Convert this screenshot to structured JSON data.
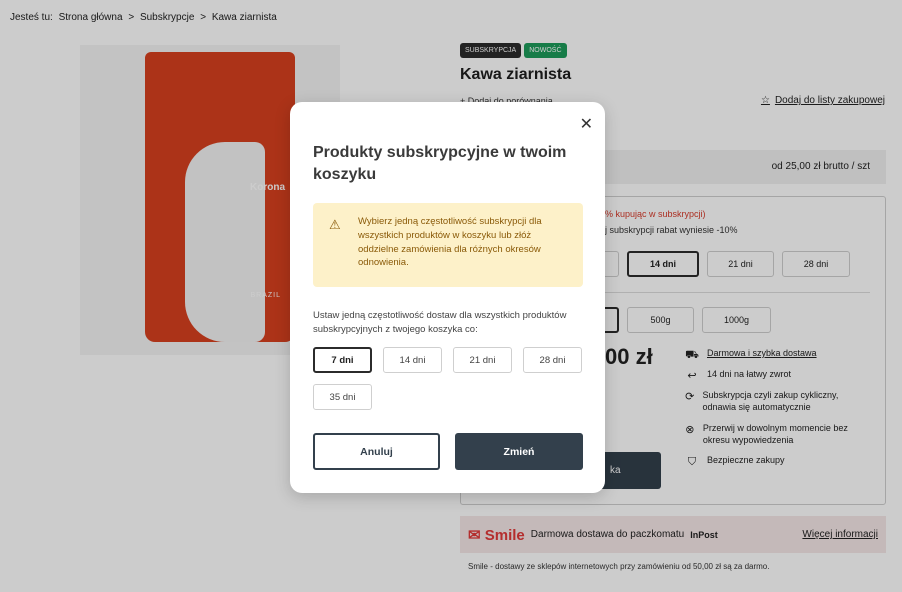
{
  "breadcrumb": {
    "prefix": "Jesteś tu:",
    "items": [
      "Strona główna",
      ">",
      "Subskrypcje",
      ">",
      "Kawa ziarnista"
    ]
  },
  "product": {
    "badges": [
      "SUBSKRYPCJA",
      "NOWOŚĆ"
    ],
    "title": "Kawa ziarnista",
    "compare": "+ Dodaj do porównania",
    "shopping_list": "Dodaj do listy zakupowej",
    "price_from": "od 25,00 zł  brutto / szt",
    "bag_brand": "Korona",
    "bag_origin": "BRAZIL"
  },
  "config": {
    "discount_red": "5% kupując w subskrypcji)",
    "discount_info": "ej subskrypcji rabat wyniesie -10%",
    "frequency_bg": [
      "14 dni",
      "21 dni",
      "28 dni"
    ],
    "weights": [
      "500g",
      "1000g"
    ],
    "price_partial": "00 zł",
    "add_to_cart_partial": "ka"
  },
  "perks": [
    {
      "icon": "truck-icon",
      "text": "Darmowa i szybka dostawa"
    },
    {
      "icon": "return-icon",
      "text": "14 dni na łatwy zwrot"
    },
    {
      "icon": "refresh-icon",
      "text": "Subskrypcja czyli zakup cykliczny, odnawia się automatycznie"
    },
    {
      "icon": "cancel-circle-icon",
      "text": "Przerwij w dowolnym momencie bez okresu wypowiedzenia"
    },
    {
      "icon": "shield-icon",
      "text": "Bezpieczne zakupy"
    }
  ],
  "smile": {
    "logo": "Smile",
    "text": "Darmowa dostawa do paczkomatu",
    "partner": "InPost",
    "more": "Więcej informacji",
    "note": "Smile - dostawy ze sklepów internetowych przy zamówieniu od 50,00 zł są za darmo."
  },
  "modal": {
    "title": "Produkty subskrypcyjne w twoim koszyku",
    "alert": "Wybierz jedną częstotliwość subskrypcji dla wszystkich produktów w koszyku lub złóż oddzielne zamówienia dla różnych okresów odnowienia.",
    "instruction": "Ustaw jedną częstotliwość dostaw dla wszystkich produktów subskrypcyjnych z twojego koszyka co:",
    "options": [
      "7 dni",
      "14 dni",
      "21 dni",
      "28 dni",
      "35 dni"
    ],
    "selected": "7 dni",
    "cancel_label": "Anuluj",
    "confirm_label": "Zmień"
  }
}
